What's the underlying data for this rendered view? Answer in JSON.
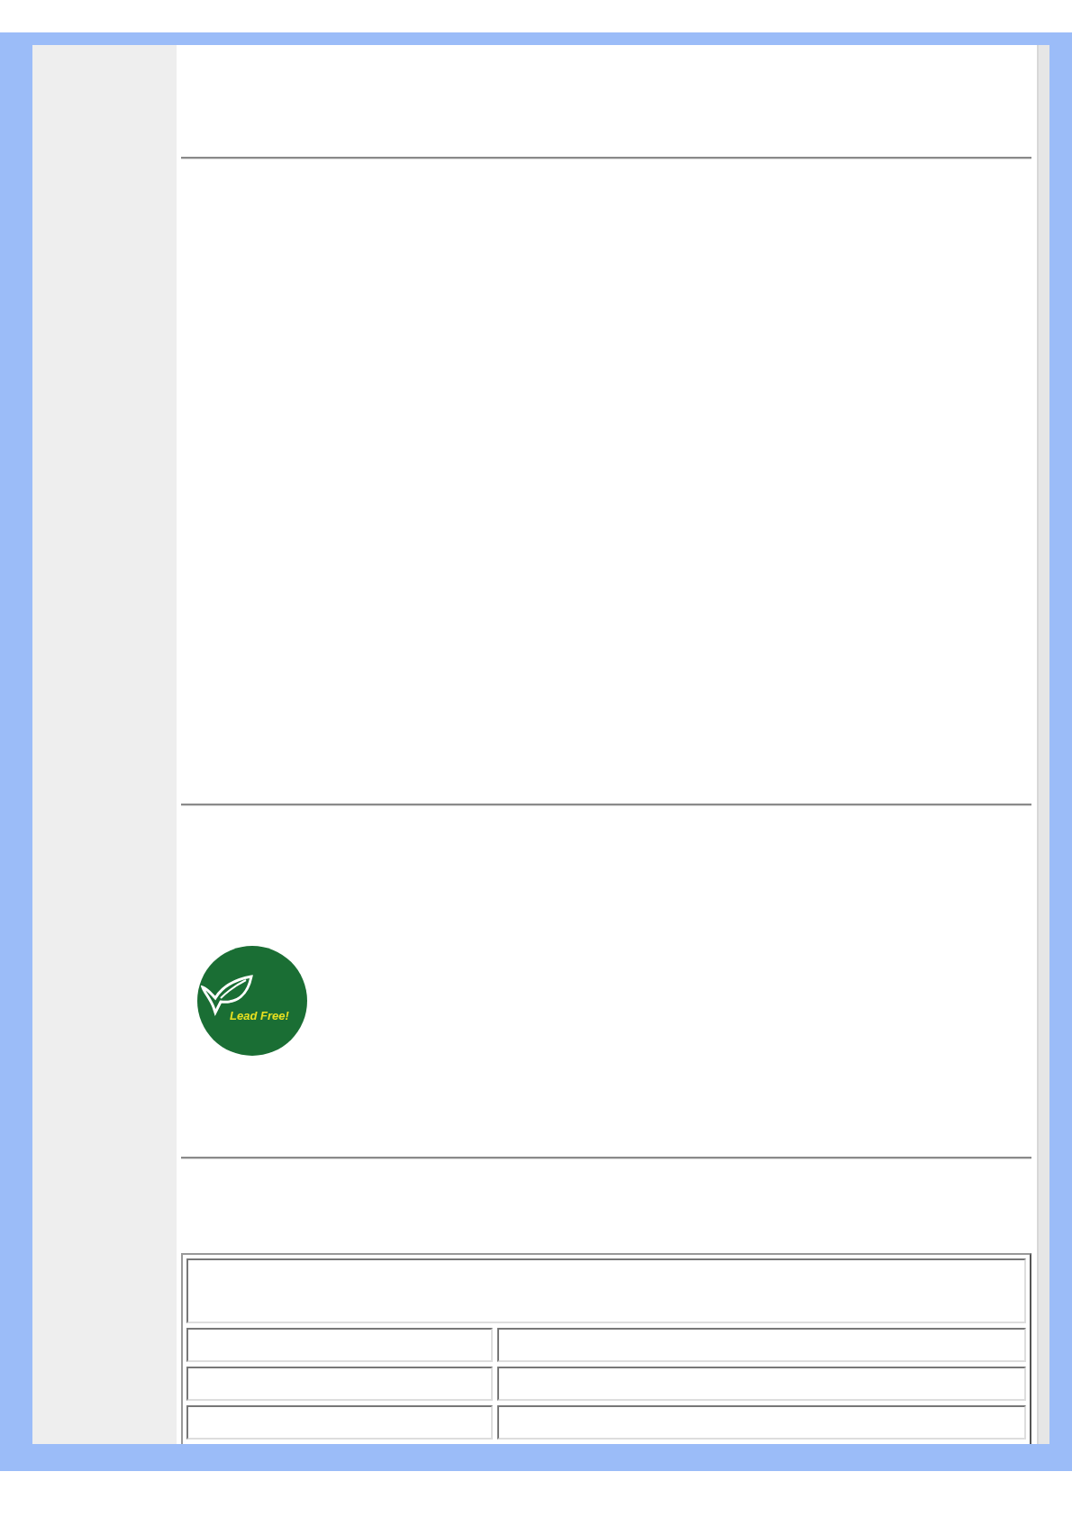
{
  "logo": {
    "text": "Lead Free!"
  }
}
